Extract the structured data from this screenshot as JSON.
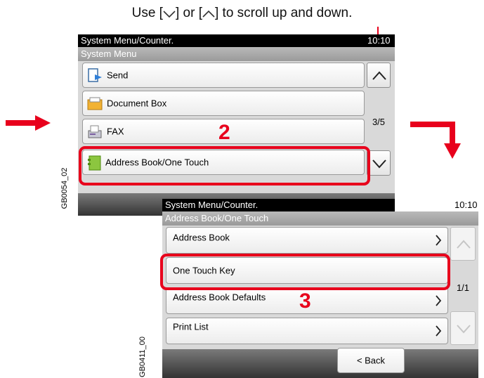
{
  "caption": {
    "prefix": "Use [",
    "mid": "] or [",
    "suffix": "] to scroll up and down.",
    "icons": [
      "chevron-down-icon",
      "chevron-up-icon"
    ]
  },
  "screen1": {
    "status_title": "System Menu/Counter.",
    "clock": "10:10",
    "header": "System Menu",
    "items": [
      {
        "label": "Send",
        "icon": "send-icon"
      },
      {
        "label": "Document Box",
        "icon": "document-box-icon"
      },
      {
        "label": "FAX",
        "icon": "fax-icon"
      },
      {
        "label": "Address Book/One Touch",
        "icon": "address-book-icon"
      }
    ],
    "page_indicator": "3/5",
    "side_label": "GB0054_02"
  },
  "screen2": {
    "status_title": "System Menu/Counter.",
    "clock": "10:10",
    "header": "Address Book/One Touch",
    "items": [
      {
        "label": "Address Book"
      },
      {
        "label": "One Touch Key"
      },
      {
        "label": "Address Book Defaults"
      },
      {
        "label": "Print List"
      }
    ],
    "page_indicator": "1/1",
    "back_label": "< Back",
    "side_label": "GB0411_00"
  },
  "steps": {
    "step2": "2",
    "step3": "3"
  },
  "colors": {
    "highlight": "#e8001c",
    "arrow": "#e8001c",
    "status_bar": "#000000"
  }
}
